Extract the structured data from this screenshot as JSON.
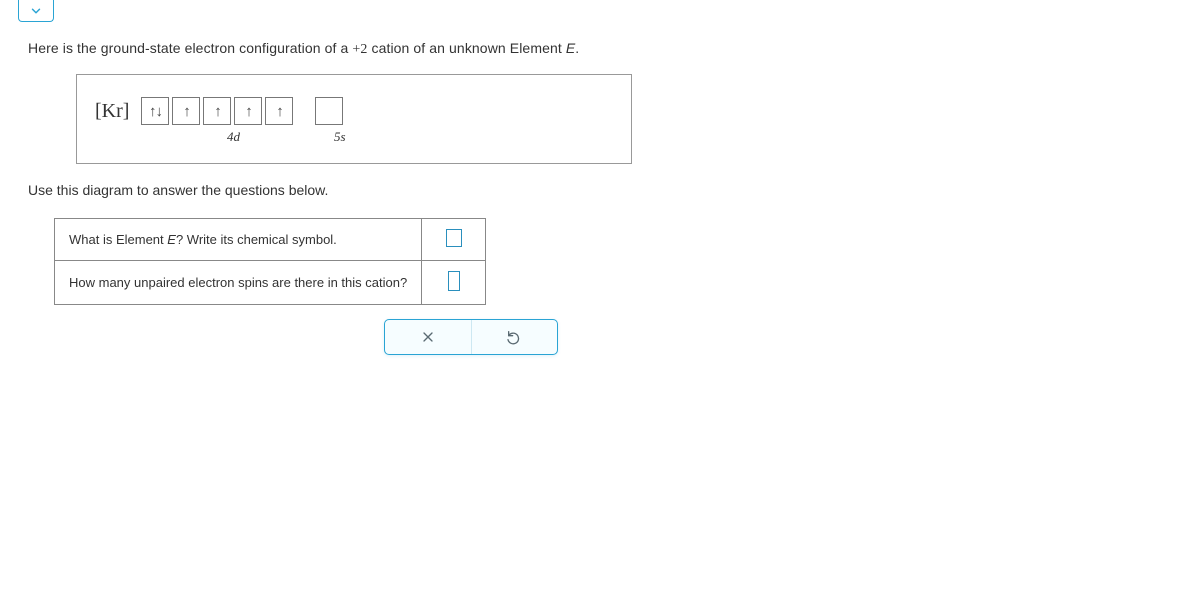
{
  "intro": {
    "prefix": "Here is the ground-state electron configuration of a ",
    "charge": "+2",
    "mid": " cation of an unknown Element ",
    "elem": "E",
    "suffix": "."
  },
  "diagram": {
    "noble": "[Kr]",
    "orbitals_4d": [
      "↑↓",
      "↑",
      "↑",
      "↑",
      "↑"
    ],
    "orbitals_5s": [
      ""
    ],
    "label_4d": "4d",
    "label_5s": "5s"
  },
  "use_line": "Use this diagram to answer the questions below.",
  "questions": {
    "q1_a": "What is Element ",
    "q1_e": "E",
    "q1_b": "? Write its chemical symbol.",
    "q2": "How many unpaired electron spins are there in this cation?"
  }
}
